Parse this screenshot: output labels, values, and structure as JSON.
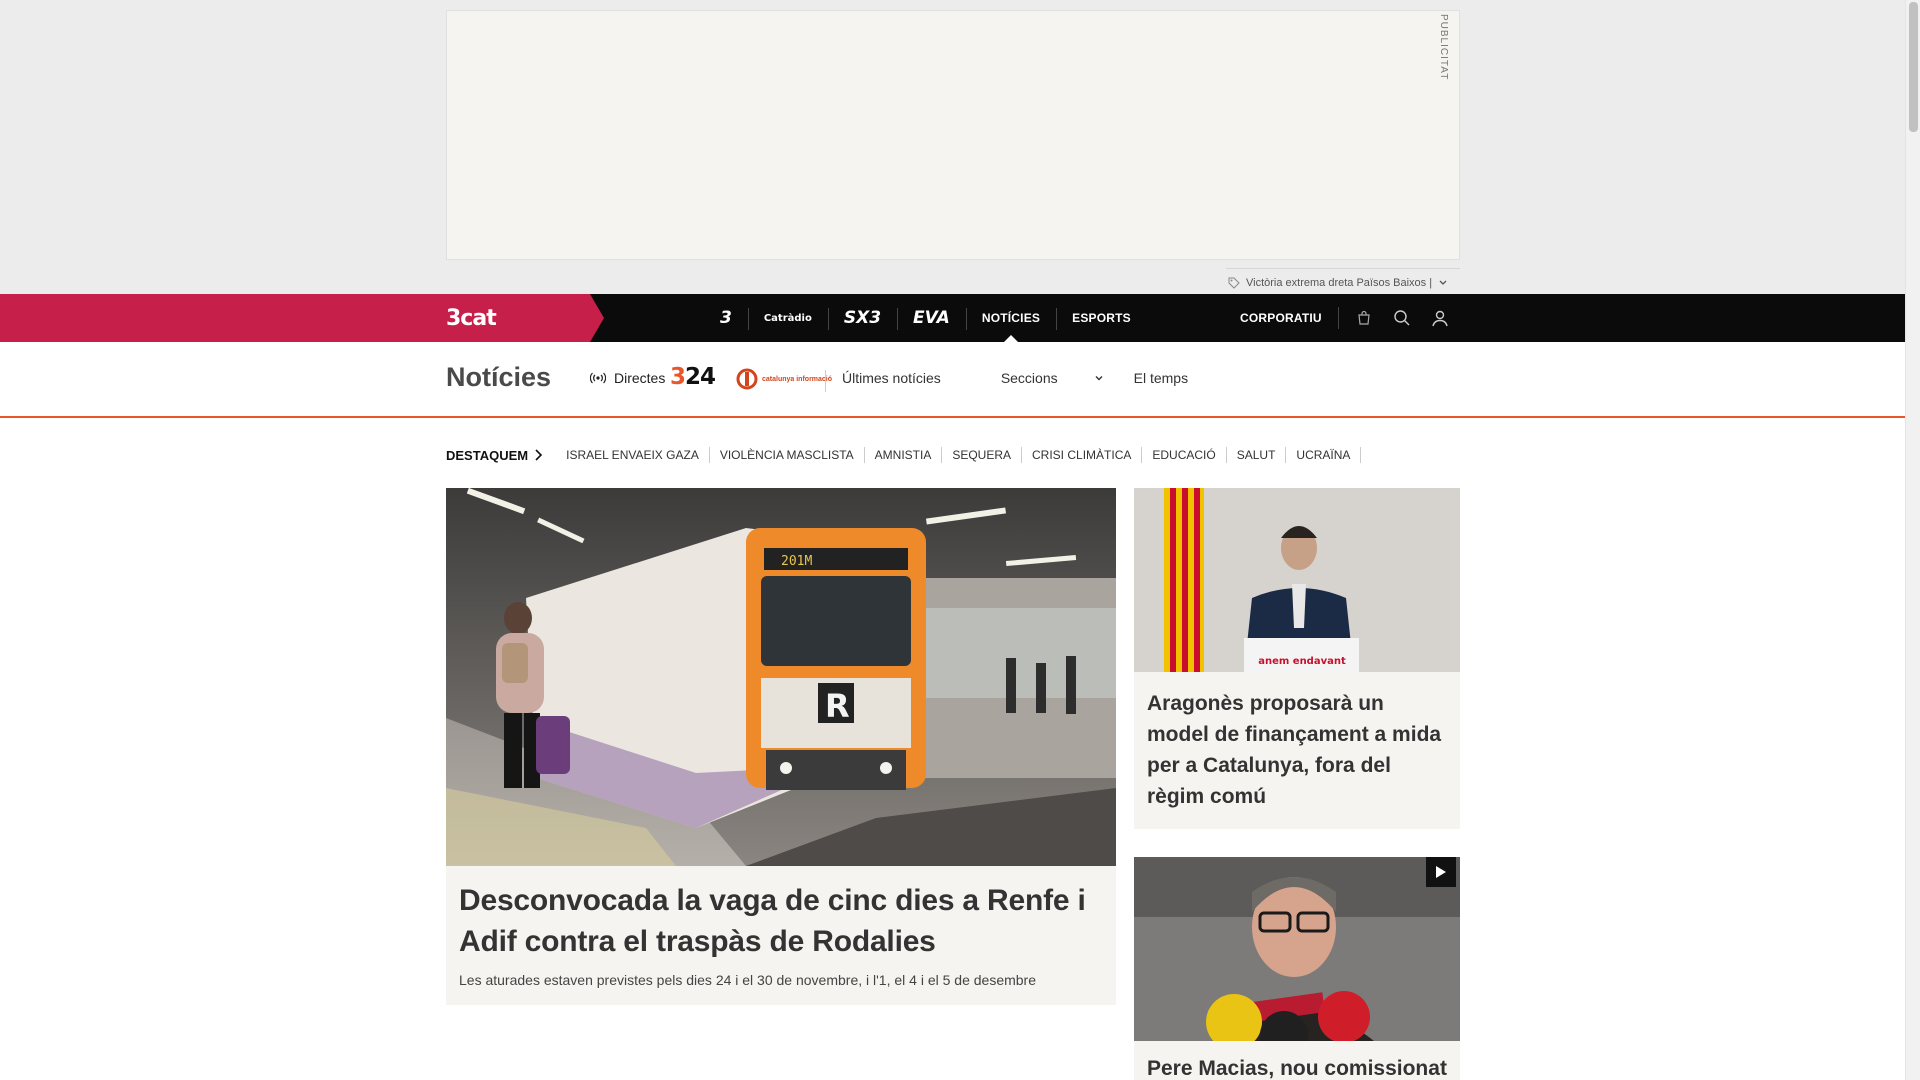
{
  "ad": {
    "label": "PUBLICITAT",
    "ticker_text": "Victòria extrema dreta Països Baixos |"
  },
  "topbar": {
    "brand": "3cat",
    "channels": [
      {
        "label": "3",
        "name": "tv3-logo"
      },
      {
        "label": "Catràdio",
        "name": "catradio-logo"
      },
      {
        "label": "SX3",
        "name": "sx3-logo"
      },
      {
        "label": "EVA",
        "name": "eva-logo"
      },
      {
        "label": "NOTÍCIES",
        "name": "noticies"
      },
      {
        "label": "ESPORTS",
        "name": "esports"
      }
    ],
    "corporate": "CORPORATIU",
    "icons": [
      "shop-icon",
      "search-icon",
      "user-icon"
    ]
  },
  "section": {
    "title": "Notícies",
    "live_label": "Directes",
    "logo_324": "324",
    "logo_ci": "catalunya informació",
    "nav": [
      "Últimes notícies",
      "Seccions",
      "El temps"
    ]
  },
  "topics": {
    "highlight": "DESTAQUEM",
    "items": [
      "ISRAEL ENVAEIX GAZA",
      "VIOLÈNCIA MASCLISTA",
      "AMNISTIA",
      "SEQUERA",
      "CRISI CLIMÀTICA",
      "EDUCACIÓ",
      "SALUT",
      "UCRAÏNA"
    ]
  },
  "main_story": {
    "title": "Desconvocada la vaga de cinc dies a Renfe i Adif contra el traspàs de Rodalies",
    "subtitle": "Les aturades estaven previstes pels dies 24 i el 30 de novembre, i l'1, el 4 i el 5 de desembre",
    "image_texts": {
      "train_number": "201M",
      "badge": "R"
    }
  },
  "side_stories": [
    {
      "title": "Aragonès proposarà un model de finançament a mida per a Catalunya, fora del règim comú",
      "image_texts": {
        "podium": "anem endavant"
      }
    },
    {
      "title": "Pere Macias, nou comissionat",
      "has_video": true
    }
  ],
  "colors": {
    "brand": "#c51f4a",
    "accent": "#e8562a",
    "topbar": "#0b0b0b",
    "card_bg": "#f5f4f1"
  }
}
